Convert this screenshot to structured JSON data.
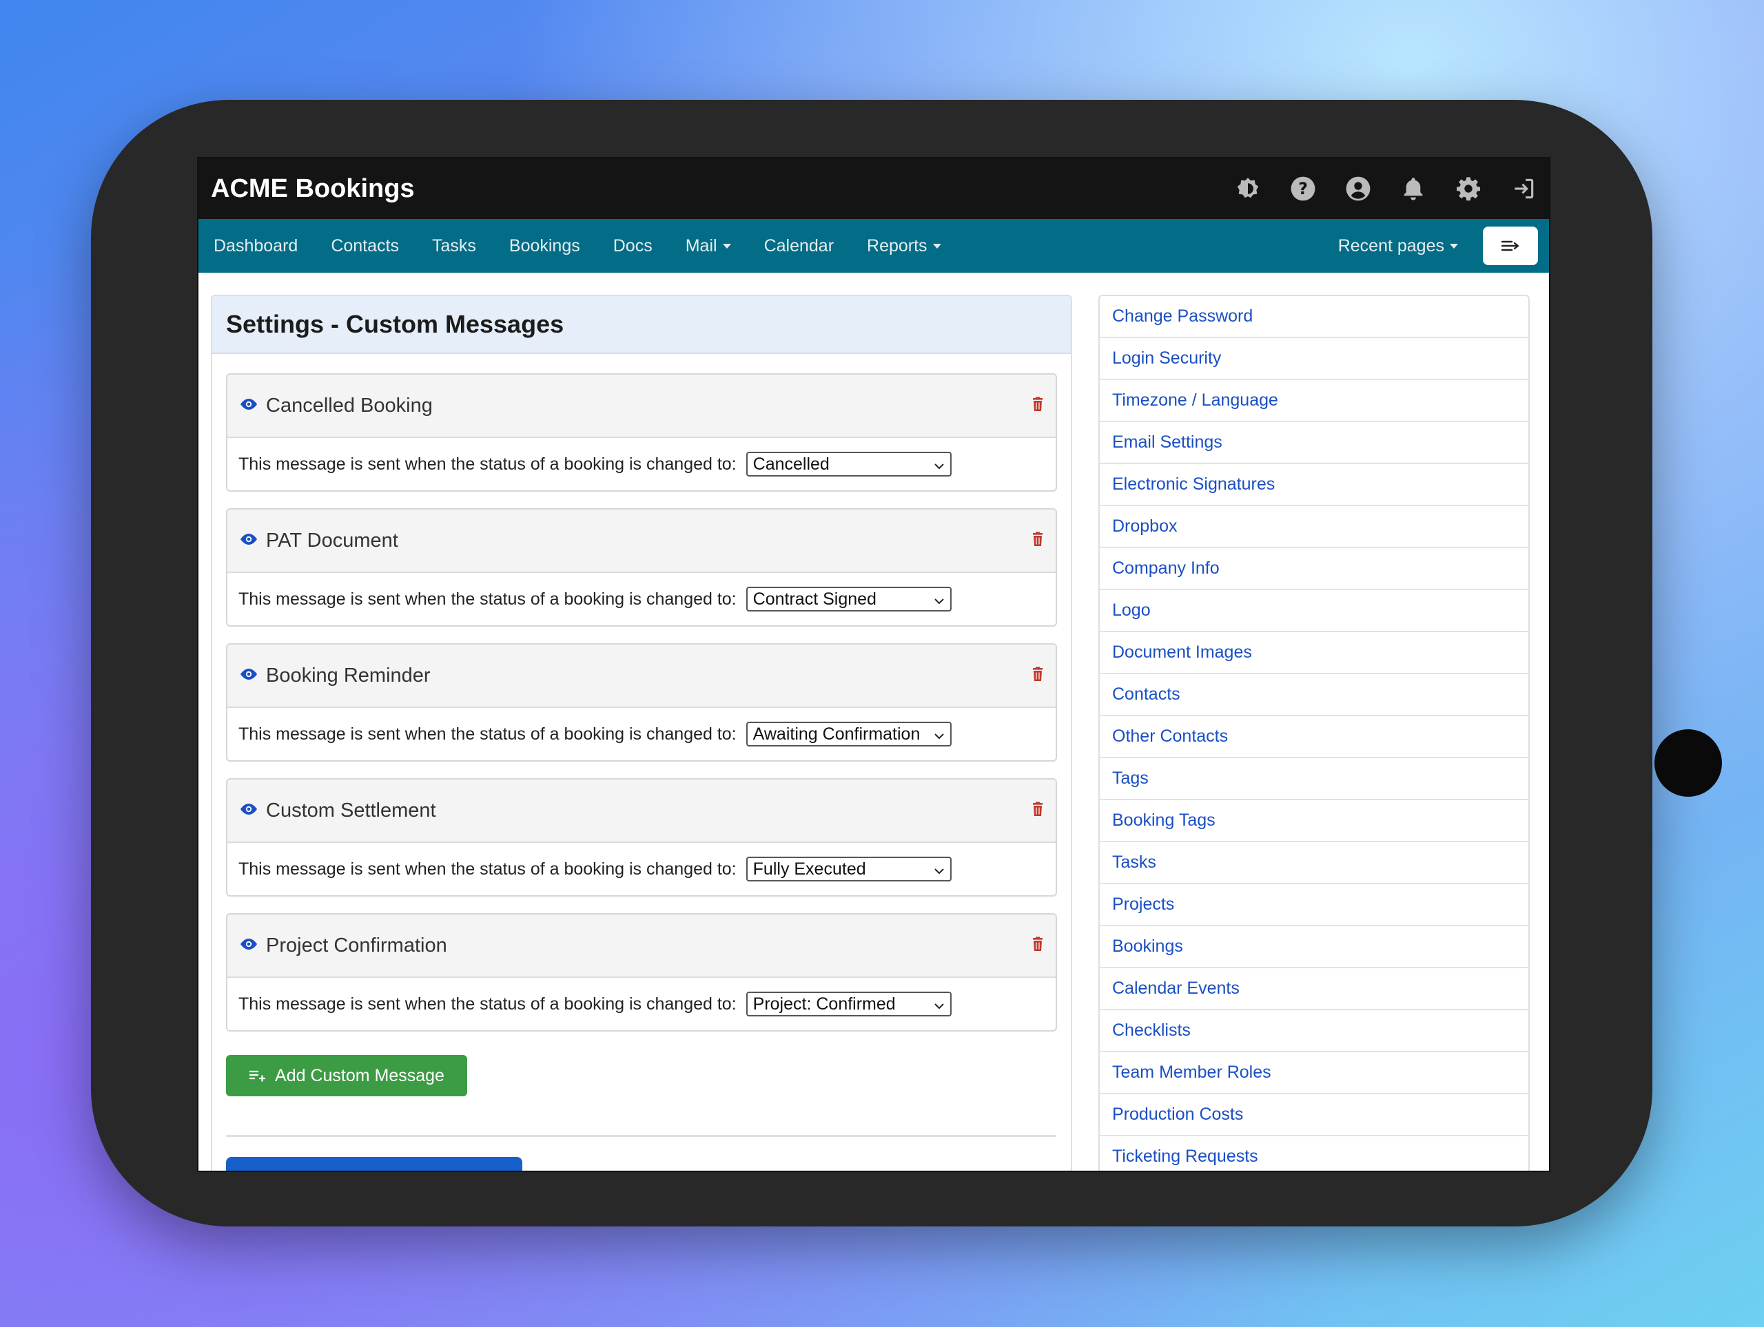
{
  "app": {
    "title": "ACME Bookings"
  },
  "top_icons": [
    "brightness-icon",
    "help-icon",
    "account-icon",
    "bell-icon",
    "gear-icon",
    "logout-icon"
  ],
  "nav": {
    "items": [
      {
        "label": "Dashboard",
        "dropdown": false
      },
      {
        "label": "Contacts",
        "dropdown": false
      },
      {
        "label": "Tasks",
        "dropdown": false
      },
      {
        "label": "Bookings",
        "dropdown": false
      },
      {
        "label": "Docs",
        "dropdown": false
      },
      {
        "label": "Mail",
        "dropdown": true
      },
      {
        "label": "Calendar",
        "dropdown": false
      },
      {
        "label": "Reports",
        "dropdown": true
      }
    ],
    "recent_pages": "Recent pages"
  },
  "main": {
    "title": "Settings - Custom Messages",
    "messages": [
      {
        "title": "Cancelled Booking",
        "description": "This message is sent when the status of a booking is changed to:",
        "status": "Cancelled"
      },
      {
        "title": "PAT Document",
        "description": "This message is sent when the status of a booking is changed to:",
        "status": "Contract Signed"
      },
      {
        "title": "Booking Reminder",
        "description": "This message is sent when the status of a booking is changed to:",
        "status": "Awaiting Confirmation"
      },
      {
        "title": "Custom Settlement",
        "description": "This message is sent when the status of a booking is changed to:",
        "status": "Fully Executed"
      },
      {
        "title": "Project Confirmation",
        "description": "This message is sent when the status of a booking is changed to:",
        "status": "Project: Confirmed"
      }
    ],
    "add_button": "Add Custom Message"
  },
  "sidebar": {
    "items": [
      "Change Password",
      "Login Security",
      "Timezone / Language",
      "Email Settings",
      "Electronic Signatures",
      "Dropbox",
      "Company Info",
      "Logo",
      "Document Images",
      "Contacts",
      "Other Contacts",
      "Tags",
      "Booking Tags",
      "Tasks",
      "Projects",
      "Bookings",
      "Calendar Events",
      "Checklists",
      "Team Member Roles",
      "Production Costs",
      "Ticketing Requests"
    ]
  },
  "colors": {
    "topbar": "#141414",
    "navbar": "#036c86",
    "link": "#1a4fc4",
    "add_button": "#3c9c44",
    "delete_icon": "#c0392b",
    "eye_icon": "#1a4fc4"
  }
}
